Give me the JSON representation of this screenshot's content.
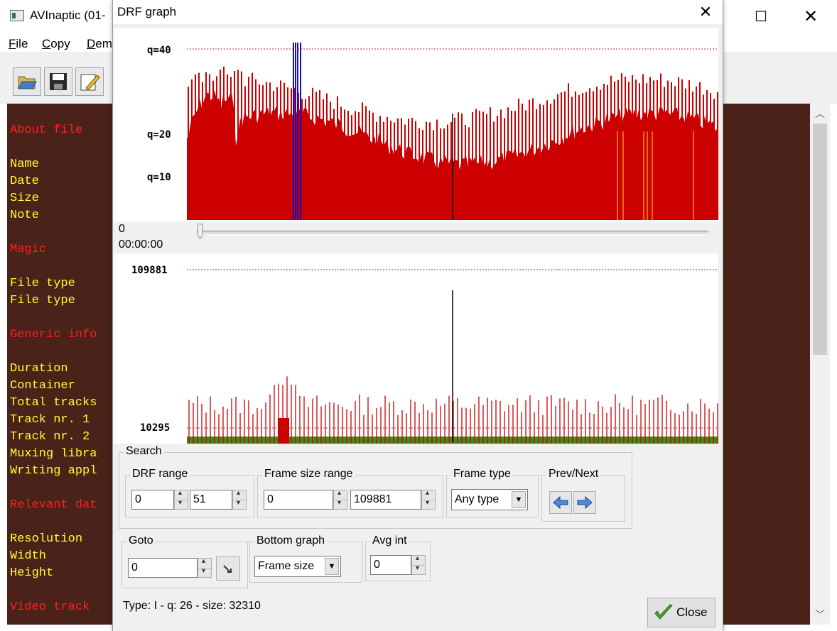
{
  "main_window": {
    "title": "AVInaptic (01-",
    "maximize_glyph": "☐",
    "close_glyph": "✕",
    "menu": [
      "File",
      "Copy",
      "Dem"
    ],
    "toolbar_icons": [
      "open-folder-icon",
      "save-icon",
      "edit-icon"
    ],
    "info_lines": [
      {
        "text": "About file",
        "kind": "heading"
      },
      {
        "text": "Name",
        "kind": "field"
      },
      {
        "text": "Date",
        "kind": "field"
      },
      {
        "text": "Size",
        "kind": "field"
      },
      {
        "text": "Note",
        "kind": "field"
      },
      {
        "text": "Magic",
        "kind": "heading"
      },
      {
        "text": "File type",
        "kind": "field"
      },
      {
        "text": "File type",
        "kind": "field"
      },
      {
        "text": "Generic info",
        "kind": "heading"
      },
      {
        "text": "Duration",
        "kind": "field"
      },
      {
        "text": "Container",
        "kind": "field"
      },
      {
        "text": "Total tracks",
        "kind": "field"
      },
      {
        "text": "Track nr. 1",
        "kind": "field"
      },
      {
        "text": "Track nr. 2",
        "kind": "field"
      },
      {
        "text": "Muxing libra",
        "kind": "field"
      },
      {
        "text": "Writing appl",
        "kind": "field"
      },
      {
        "text": "Relevant dat",
        "kind": "heading"
      },
      {
        "text": "Resolution",
        "kind": "field"
      },
      {
        "text": "Width",
        "kind": "field"
      },
      {
        "text": "Height",
        "kind": "field"
      },
      {
        "text": "Video track",
        "kind": "heading"
      }
    ],
    "colors": {
      "pane_bg": "#4a2219",
      "heading": "#ff2020",
      "field": "#ffff30"
    }
  },
  "dialog": {
    "title": "DRF graph",
    "close_glyph": "✕",
    "top_graph": {
      "labels": [
        "q=40",
        "q=20",
        "q=10"
      ]
    },
    "slider": {
      "frame": "0",
      "time": "00:00:00",
      "position": 0
    },
    "bottom_graph": {
      "labels": [
        "109881",
        "10295"
      ]
    },
    "search": {
      "label": "Search",
      "drf_range": {
        "label": "DRF range",
        "from": "0",
        "to": "51"
      },
      "frame_size_range": {
        "label": "Frame size range",
        "from": "0",
        "to": "109881"
      },
      "frame_type": {
        "label": "Frame type",
        "value": "Any type"
      },
      "prev_next": {
        "label": "Prev/Next"
      }
    },
    "goto": {
      "label": "Goto",
      "value": "0"
    },
    "bottom_graph_select": {
      "label": "Bottom graph",
      "value": "Frame size"
    },
    "avg_int": {
      "label": "Avg int",
      "value": "0"
    },
    "status": "Type: I - q: 26 - size: 32310",
    "close_label": "Close",
    "colors": {
      "drf_bar": "#cc0000",
      "drf_outline": "#b00000",
      "selected_bar": "#1010c0",
      "marker_bar": "#ffb400",
      "size_green": "#3c8c1e",
      "ref_line": "#b03030"
    }
  }
}
